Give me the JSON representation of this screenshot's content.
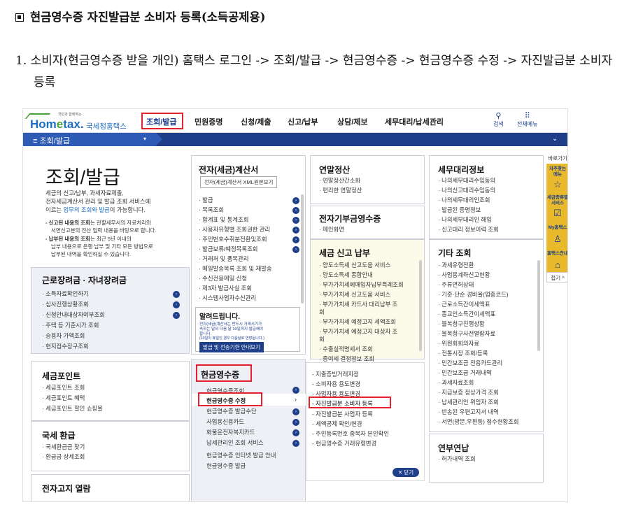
{
  "doc": {
    "title": "현금영수증 자진발급분 소비자 등록(소득공제용)",
    "step": "1. 소비자(현금영수증 받을 개인) 홈택스 로그인 -> 조회/발급 -> 현금영수증 -> 현금영수증 수정 -> 자진발급분 소비자 등록"
  },
  "header": {
    "logo_small": "국민과 함께하는",
    "logo_main": "Hom",
    "logo_e": "e",
    "logo_tax": "tax.",
    "logo_kr": "국세청홈택스",
    "menus": [
      "조회/발급",
      "민원증명",
      "신청/제출",
      "신고/납부",
      "상담/제보",
      "세무대리/납세관리"
    ],
    "search": "검색",
    "allmenu": "전체메뉴",
    "search_icon": "search-icon",
    "grid_icon": "grid-icon"
  },
  "bar": {
    "label": "≡  조회/발급",
    "dropdown": "▾",
    "right": "⌄"
  },
  "left": {
    "big": "조회/발급",
    "desc1": "세금의 신고/납부, 과세자료제출,",
    "desc2": "전자세금계산서 관리 및 발급 조회 서비스에",
    "desc3a": "이르는 ",
    "desc3b": "업무의 조회와 발급",
    "desc3c": "이 가능합니다.",
    "note1a": "- 신고된 내용의 조회",
    "note1b": "는 관할세무서의 자료처리와",
    "note2": "서면신고분의 전산 입력 내용을 바탕으로 합니다.",
    "note3a": "- 납부된 내용의 조회",
    "note3b": "는 최근 5년 이내의",
    "note4": "납부 내용으로 은행 납부 및 기타 모든 방법으로",
    "note5": "납부된 내역을 확인하실 수 있습니다."
  },
  "labor": {
    "title": "근로장려금 · 자녀장려금",
    "items": [
      "· 소득자료확인하기",
      "· 심사진행상황조회",
      "· 신청안내대상자여부조회",
      "· 주택 등 기준시가 조회",
      "· 승용차 가액조회",
      "· 현지접수장구조회"
    ]
  },
  "point": {
    "title": "세금포인트",
    "items": [
      "· 세금포인트 조회",
      "· 세금포인트 혜택",
      "· 세금포인트 할인 쇼핑몰"
    ]
  },
  "refund": {
    "title": "국세 환급",
    "items": [
      "· 국세환급금 찾기",
      "· 환급금 상세조회"
    ]
  },
  "ebill": {
    "title": "전자고지 열람"
  },
  "etax": {
    "title": "전자(세금)계산서",
    "boxbtn": "전자(세금)계산서 XML원본보기",
    "items": [
      "· 발급",
      "· 목록조회",
      "· 합계표 및 통계조회",
      "· 사용자유형별 조회권한 관리",
      "· 주민번호수취분전환및조회",
      "· 발급보류/예정목록조회",
      "· 거래처 및 품목관리",
      "· 메일발송목록 조회 및 재발송",
      "· 수신전용메일 신청",
      "· 제3자 발급사실 조회",
      "· 시스템사업자수신관리"
    ]
  },
  "notice": {
    "title": "알려드립니다.",
    "l1": "전자(세금)계산서는 반드시 거래시기가",
    "l2": "속하는 달의 다음 달 10일까지 발급해야",
    "l3": "합니다.",
    "l4": "(10일이 휴일인 경우 다음날로 연장됩니다.)",
    "btn": "발급 및 전송기한 안내보기"
  },
  "yearend": {
    "title": "연말정산",
    "items": [
      "· 연말정산간소화",
      "· 편리한 연말정산"
    ]
  },
  "ereceipt": {
    "title": "전자기부금영수증",
    "items": [
      "· 메인화면"
    ]
  },
  "taxfile": {
    "title": "세금 신고 납부",
    "items": [
      "· 양도소득세 신고도움 서비스",
      "· 양도소득세 종합안내",
      "· 부가가치세예매입자납부특례조회",
      "· 부가가치세 신고도움 서비스",
      "· 부가가치세 카드사 대리납부 조",
      "  회",
      "· 부가가치세 예정고지 세액조회",
      "· 부가가치세 예정고지 대상자 조",
      "  회",
      "· 수출실적명세서 조회",
      "· 증여세 결정정보 조회"
    ]
  },
  "agent": {
    "title": "세무대리정보",
    "items": [
      "· 나의세무대리수임동의",
      "· 나의신고대리수임동의",
      "· 나의세무대리인조회",
      "· 발급된 증명정보",
      "· 나의세무대리인 해임",
      "· 신고대리 정보이력 조회"
    ]
  },
  "etc": {
    "title": "기타 조회",
    "items": [
      "· 과세유형전환",
      "· 사업용계좌신고현황",
      "· 주류면허상태",
      "· 기준·단순 경비율(업종코드)",
      "· 근로소득간이세액표",
      "· 종교인소득간이세액표",
      "· 불복청구진행상황",
      "· 불복청구사전열람자료",
      "· 위원회회의자료",
      "· 전통시장 조회/등록",
      "· 민간보조금 전용카드관리",
      "· 민간보조금 거래내역",
      "· 과세자료조회",
      "· 지급보증 정상가격 조회",
      "· 납세관리인 위임자 조회",
      "· 반송된 우편고지서 내역",
      "· 서면(방문,우편등) 접수현황조회"
    ]
  },
  "yearly": {
    "title": "연부연납",
    "items": [
      "· 허가내역 조회"
    ]
  },
  "cash": {
    "title": "현금영수증",
    "items": [
      "현금영수증조회",
      "현금영수증 수정",
      "현금영수증 발급수단",
      "사업용신용카드",
      "화물운전자복지카드",
      "납세관리인 조회 서비스",
      "현금영수증 인터넷 발급 안내",
      "현금영수증 발급"
    ]
  },
  "submenu": {
    "items": [
      "- 지출증빙거래지정",
      "- 소비자용 용도변경",
      "- 사업자용 용도변경",
      "- 자진발급분 소비자 등록",
      "- 자진발급분 사업자 등록",
      "- 세액공제 확인/변경",
      "- 주민등록번호 중복자 본인확인",
      "- 현금영수증 거래유형변경"
    ],
    "close": "✕ 닫기"
  },
  "quick": {
    "head": "바로가기",
    "t1": "자주찾는\n메뉴",
    "t2": "세금종류별\n서비스",
    "t3": "My홈택스",
    "t4": "홈택스안내",
    "fold": "접기 ^"
  }
}
